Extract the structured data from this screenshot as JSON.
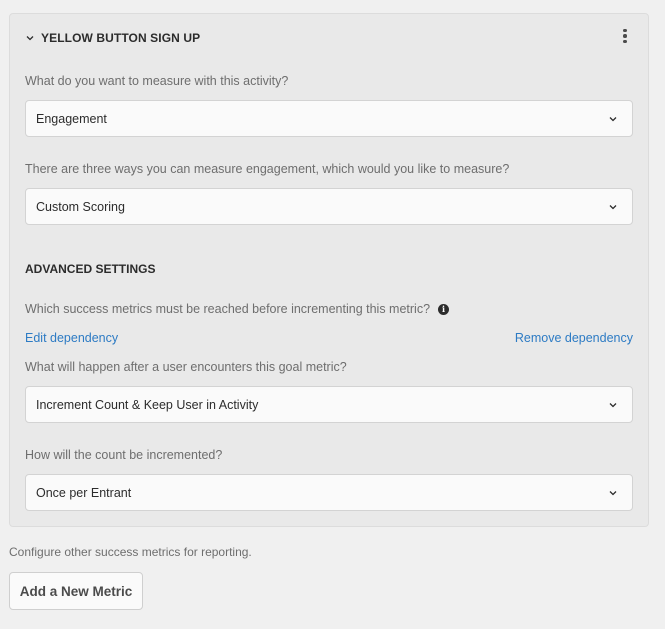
{
  "panel": {
    "title": "YELLOW BUTTON SIGN UP",
    "more_icon": "more-vertical-icon",
    "collapse_icon": "chevron-down-icon"
  },
  "fields": [
    {
      "label": "What do you want to measure with this activity?",
      "value": "Engagement"
    },
    {
      "label": "There are three ways you can measure engagement, which would you like to measure?",
      "value": "Custom Scoring"
    }
  ],
  "advanced": {
    "title": "ADVANCED SETTINGS",
    "dependency_question": "Which success metrics must be reached before incrementing this metric?",
    "info_icon": "info-icon",
    "edit_dependency": "Edit dependency",
    "remove_dependency": "Remove dependency",
    "goal_label": "What will happen after a user encounters this goal metric?",
    "goal_value": "Increment Count & Keep User in Activity",
    "count_label": "How will the count be incremented?",
    "count_value": "Once per Entrant"
  },
  "footer": {
    "text": "Configure other success metrics for reporting.",
    "add_button": "Add a New Metric"
  },
  "colors": {
    "link": "#2d7bc4",
    "panel_bg": "#e9e9e9",
    "page_bg": "#f0f0f0"
  }
}
